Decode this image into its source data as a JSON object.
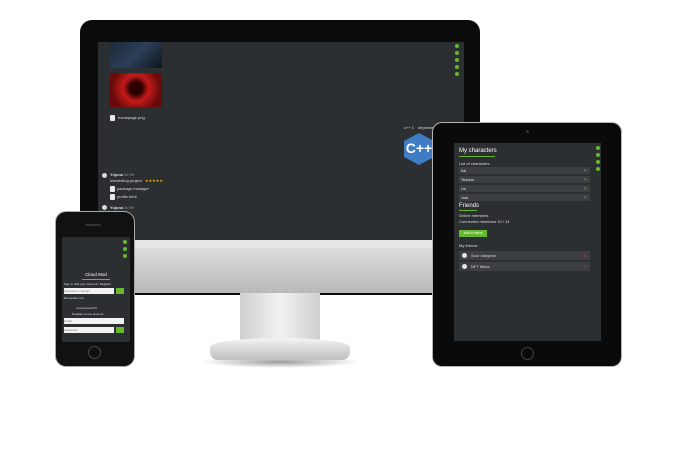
{
  "desktop": {
    "file_name": "homepage.png",
    "comment_user": "Yujuna",
    "comment_time": "2d 9h",
    "comment_text": "Interesting project",
    "comment_stars": "★★★★★",
    "attachments": [
      "package.manager",
      "profile.html"
    ],
    "cpp_logo_text": "C++",
    "cpp_caption_left": "c++ 1",
    "cpp_caption_right": "dependency manager",
    "second_user": "Yujuna",
    "second_time": "2d 9h"
  },
  "tablet": {
    "heading": "My characters",
    "subheading": "List of characters",
    "characters": [
      "Kai",
      "Tsubasa",
      "Lia",
      "Jack"
    ],
    "friends_heading": "Friends",
    "friends_sub": "Online members",
    "friends_count": "Connected members 10 / 14",
    "add_button": "Add a friend",
    "my_list_label": "My friends",
    "friends": [
      "Sour dungeon",
      "NFT Meka"
    ]
  },
  "phone": {
    "title": "Cloud Mod",
    "subtitle": "Sign in with your account / Register",
    "username_placeholder": "Username or Email",
    "remember_label": "Remember me",
    "forgot_label": "Lost password?",
    "register_label": "Register a new account",
    "email_placeholder": "Email",
    "password_placeholder": "Password"
  },
  "colors": {
    "accent": "#66b82e",
    "screen_bg": "#2c2f31",
    "danger": "#d63a3a"
  }
}
